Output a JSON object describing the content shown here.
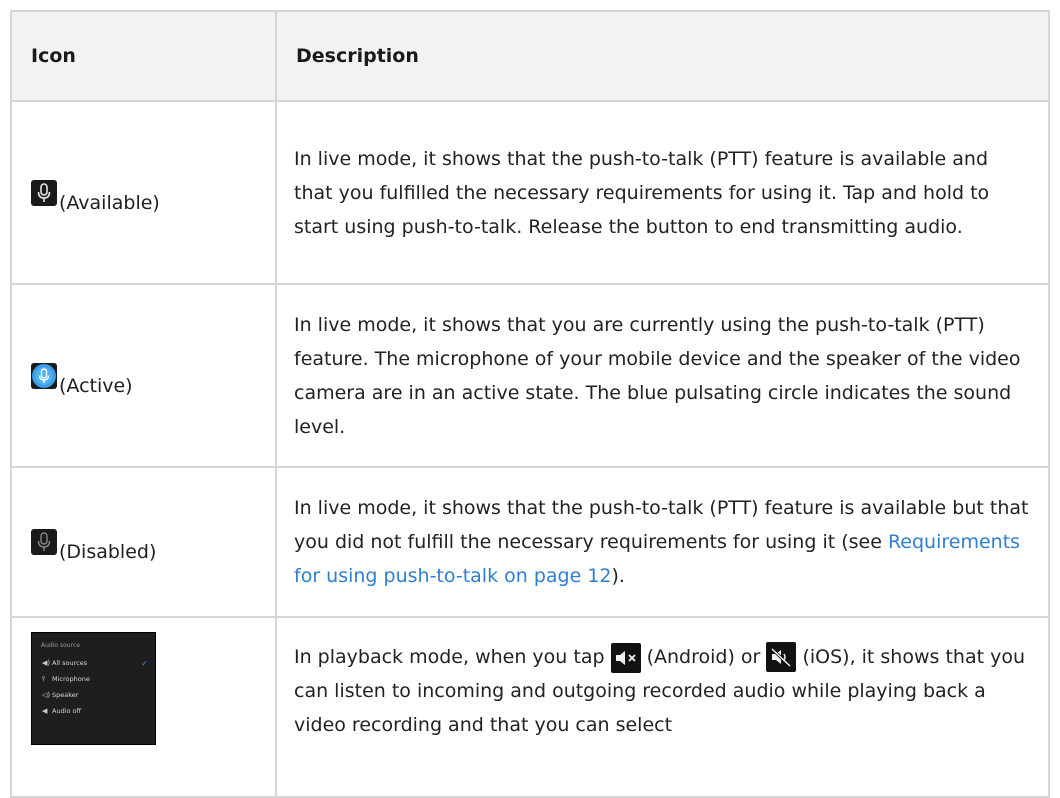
{
  "header": {
    "icon_col": "Icon",
    "description_col": "Description"
  },
  "rows": [
    {
      "icon": "mic-available-icon",
      "label": "(Available)",
      "description": "In live mode, it shows that the push-to-talk (PTT) feature is available and that you fulfilled the necessary requirements for using it. Tap and hold to start using push-to-talk. Release the button to end transmitting audio."
    },
    {
      "icon": "mic-active-icon",
      "label": "(Active)",
      "description": "In live mode, it shows that you are currently using the push-to-talk (PTT) feature. The microphone of your mobile device and the speaker of the video camera are in an active state. The blue pulsating circle indicates the sound level."
    },
    {
      "icon": "mic-disabled-icon",
      "label": "(Disabled)",
      "description_before": "In live mode, it shows that the push-to-talk (PTT) feature is available but that you did not fulfill the necessary requirements for using it (see ",
      "link": "Requirements for using push-to-talk on page 12",
      "description_after": ")."
    },
    {
      "icon": "audio-source-panel",
      "panel": {
        "title": "Audio source",
        "items": [
          {
            "icon": "speaker-icon",
            "label": "All sources",
            "selected": true
          },
          {
            "icon": "microphone-icon",
            "label": "Microphone",
            "selected": false
          },
          {
            "icon": "speaker-outline-icon",
            "label": "Speaker",
            "selected": false
          },
          {
            "icon": "audio-off-icon",
            "label": "Audio off",
            "selected": false
          }
        ]
      },
      "desc_part1": "In playback mode, when you tap ",
      "android_label": " (Android) or ",
      "ios_label": " (iOS), it shows that you can listen to incoming and outgoing recorded audio while playing back a video recording and that you can select"
    }
  ],
  "colors": {
    "link": "#2f7fd0",
    "border": "#d6d6d6",
    "header_bg": "#f3f3f3",
    "mic_active": "#3a9be8"
  }
}
